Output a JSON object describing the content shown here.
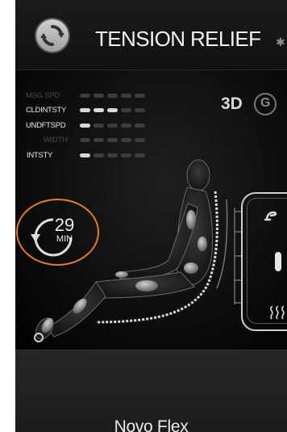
{
  "header": {
    "title": "TENSION RELIEF",
    "bluetooth_icon": "bluetooth-icon",
    "mode_icon": "refresh-icon"
  },
  "levels": [
    {
      "label": "MSG SPD",
      "value": 0,
      "max": 5
    },
    {
      "label": "CLDINTSTY",
      "value": 3,
      "max": 5
    },
    {
      "label": "UNDFTSPD",
      "value": 1,
      "max": 5
    },
    {
      "label": "WIDTH",
      "value": 0,
      "max": 5
    },
    {
      "label": "INTSTY",
      "value": 1,
      "max": 5
    }
  ],
  "badge": {
    "label": "3D",
    "icon": "g-logo-icon"
  },
  "timer": {
    "value": "29",
    "unit": "MIN"
  },
  "footer": {
    "name": "Novo Flex"
  },
  "colors": {
    "accent": "#e87b22",
    "background": "#000000",
    "level_on": "#d9d9d9",
    "level_off": "#3d3d3d"
  }
}
